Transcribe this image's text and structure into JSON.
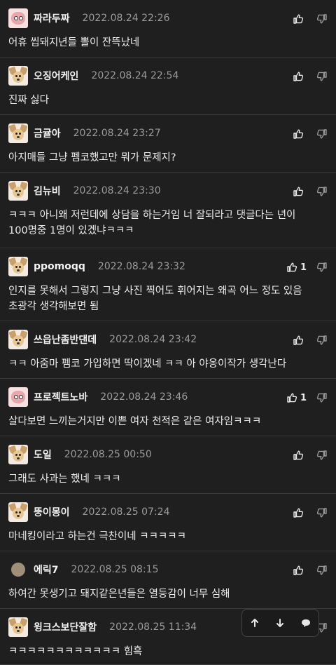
{
  "comments": [
    {
      "avatar": "pink",
      "name": "짜라두짜",
      "time": "2022.08.24 22:26",
      "likes": "",
      "text": "어휴 씹돼지년들 뽈이 잔뜩났네"
    },
    {
      "avatar": "dog",
      "name": "오징어케인",
      "time": "2022.08.24 22:54",
      "likes": "",
      "text": "진짜 싫다"
    },
    {
      "avatar": "dog",
      "name": "금귤아",
      "time": "2022.08.24 23:27",
      "likes": "",
      "text": "아지매들 그냥 펨코했고만 뭐가 문제지?"
    },
    {
      "avatar": "dog",
      "name": "김뉴비",
      "time": "2022.08.24 23:30",
      "likes": "",
      "text": "ㅋㅋㅋ 아니왜 저런데에 상담을 하는거임 너 잘되라고 댓글다는 년이\n100명중 1명이 있겠냐ㅋㅋㅋ"
    },
    {
      "avatar": "dog",
      "name": "ppomoqq",
      "time": "2022.08.24 23:32",
      "likes": "1",
      "text": "인지를 못해서 그렇지 그냥 사진 찍어도 휘어지는 왜곡 어느 정도 있음\n초광각 생각해보면 됨"
    },
    {
      "avatar": "dog",
      "name": "쓰읍난좀반댄데",
      "time": "2022.08.24 23:42",
      "likes": "",
      "text": "ㅋㅋ 아줌마 펨코 가입하면 딱이겠네 ㅋㅋ 아 야옹이작가 생각난다"
    },
    {
      "avatar": "pink",
      "name": "프로젝트노바",
      "time": "2022.08.24 23:46",
      "likes": "1",
      "text": "살다보면 느끼는거지만 이쁜 여자 천적은 같은 여자임ㅋㅋㅋ"
    },
    {
      "avatar": "dog",
      "name": "도일",
      "time": "2022.08.25 00:50",
      "likes": "",
      "text": "그래도 사과는 했네 ㅋㅋㅋ"
    },
    {
      "avatar": "dog",
      "name": "뚱이몽이",
      "time": "2022.08.25 07:24",
      "likes": "",
      "text": "마네킹이라고 하는건 극찬이네 ㅋㅋㅋㅋㅋ"
    },
    {
      "avatar": "plain",
      "name": "에릭7",
      "time": "2022.08.25 08:15",
      "likes": "",
      "text": "하여간 못생기고 돼지같은년들은 열등감이 너무 심해"
    },
    {
      "avatar": "dog",
      "name": "윙크스보단잘함",
      "time": "2022.08.25 11:34",
      "likes": "",
      "text": "ㅋㅋㅋㅋㅋㅋㅋㅋㅋㅋㅋㅋ 힘흑"
    }
  ],
  "toolbar": {
    "icons": [
      "arrow-up-icon",
      "arrow-down-icon",
      "speech-bubble-icon"
    ]
  }
}
